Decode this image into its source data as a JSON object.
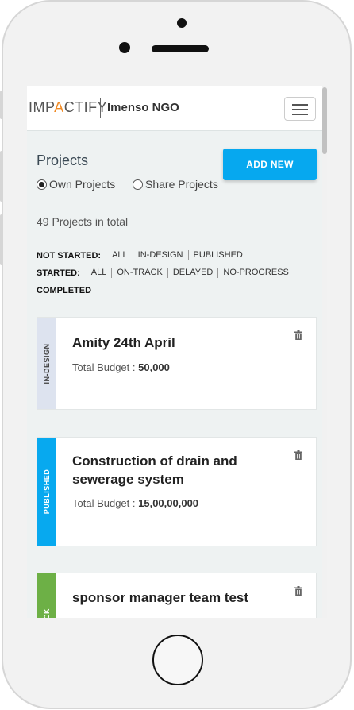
{
  "header": {
    "logo_prefix": "IMP",
    "logo_accent": "A",
    "logo_suffix": "CTIFY",
    "org_name": "Imenso NGO"
  },
  "page": {
    "title": "Projects",
    "add_button_label": "ADD NEW",
    "radio_own": "Own Projects",
    "radio_share": "Share Projects",
    "total_text": "49 Projects in total"
  },
  "filters": {
    "not_started": {
      "label": "NOT STARTED:",
      "options": [
        "ALL",
        "IN-DESIGN",
        "PUBLISHED"
      ]
    },
    "started": {
      "label": "STARTED:",
      "options": [
        "ALL",
        "ON-TRACK",
        "DELAYED",
        "NO-PROGRESS"
      ]
    },
    "completed": {
      "label": "COMPLETED"
    }
  },
  "projects": [
    {
      "status": "IN-DESIGN",
      "title": "Amity 24th April",
      "budget_label": "Total Budget :",
      "budget_value": "50,000",
      "strip_color": "#dde3ef",
      "status_color": "#444444"
    },
    {
      "status": "PUBLISHED",
      "title": "Construction of drain and sewerage system",
      "budget_label": "Total Budget :",
      "budget_value": "15,00,00,000",
      "strip_color": "#07a9ef",
      "status_color": "#ffffff"
    },
    {
      "status": "ON-TRACK",
      "title": "sponsor manager team test",
      "budget_label": "",
      "budget_value": "",
      "strip_color": "#6db046",
      "status_color": "#ffffff"
    }
  ],
  "icons": {
    "menu": "hamburger-menu-icon",
    "delete": "trash-icon"
  },
  "colors": {
    "accent": "#06a8ef",
    "logo_accent": "#f08a24"
  }
}
